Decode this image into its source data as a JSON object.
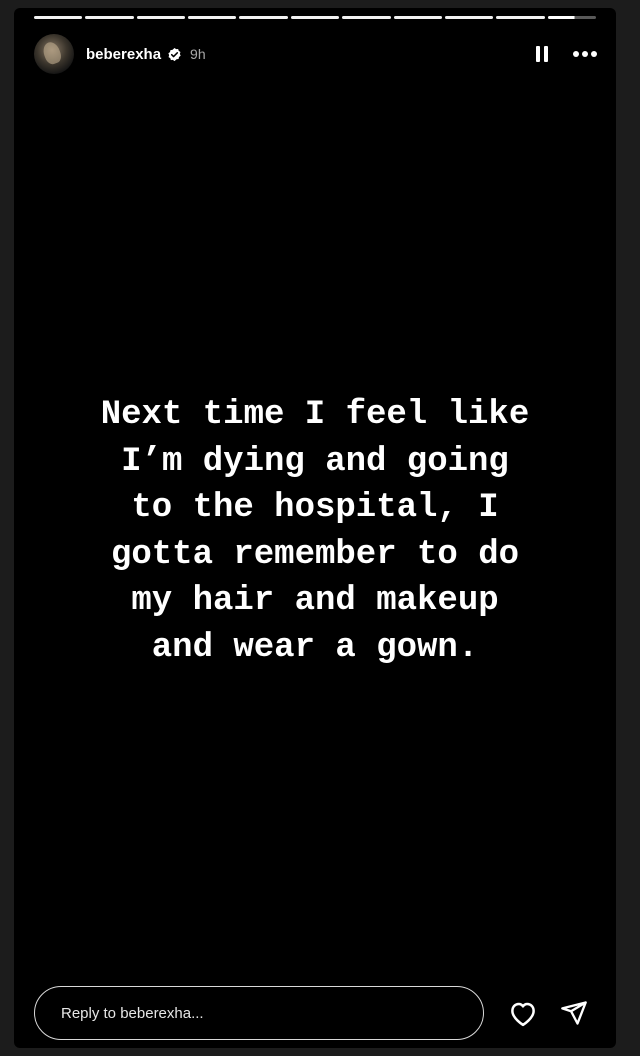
{
  "story": {
    "username": "beberexha",
    "time_ago": "9h",
    "progress_segments": 11,
    "text_lines": [
      "Next time I feel like",
      "I’m dying and going",
      "to the hospital, I",
      "gotta remember to do",
      "my hair and makeup",
      "and wear a gown."
    ],
    "reply_placeholder": "Reply to beberexha...",
    "icons": {
      "verified": "verified-badge-icon",
      "pause": "pause-icon",
      "more": "more-options-icon",
      "like": "heart-icon",
      "share": "send-icon"
    },
    "colors": {
      "background": "#000000",
      "frame": "#1c1c1c",
      "text": "#ffffff"
    }
  }
}
